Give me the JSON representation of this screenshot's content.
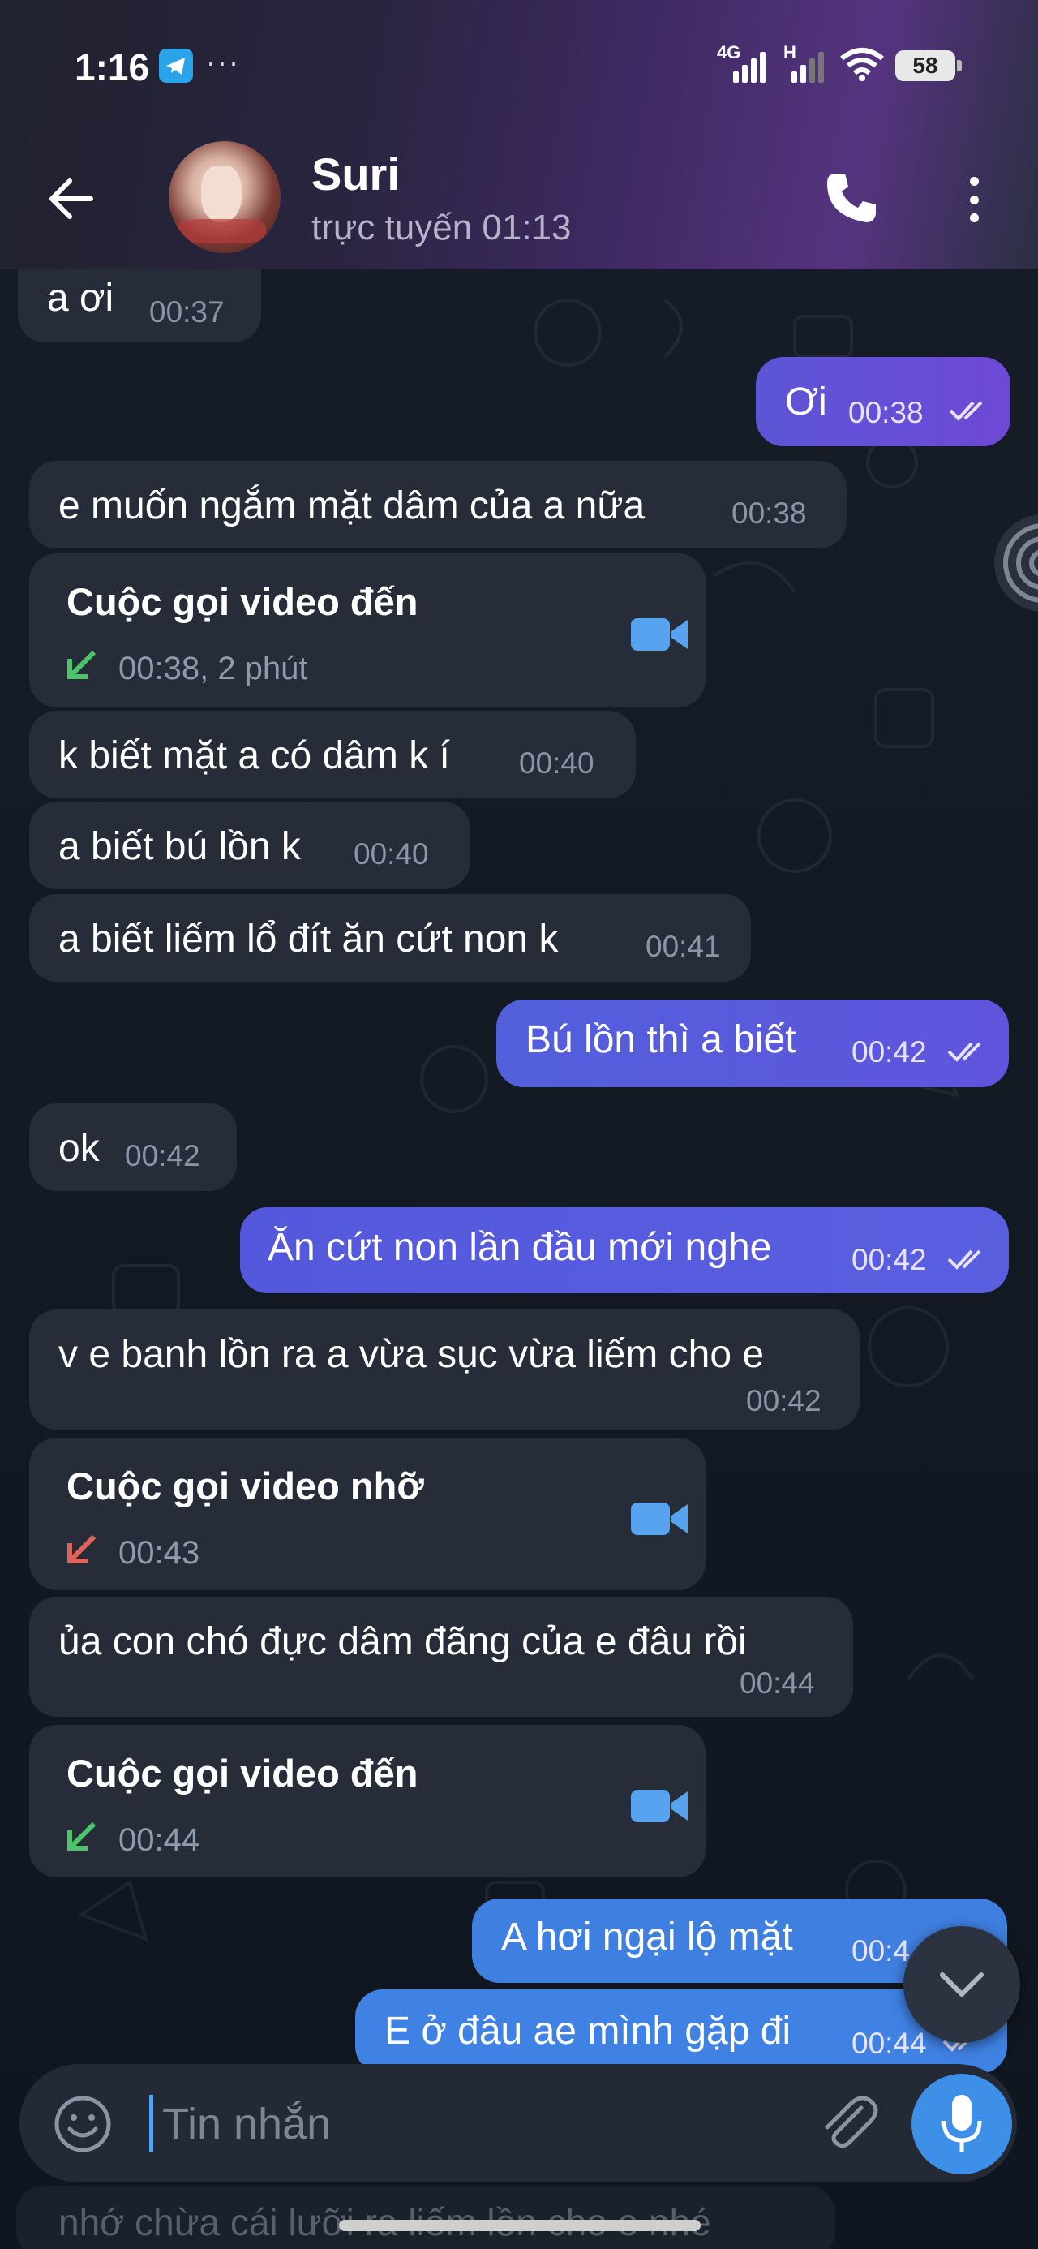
{
  "status_bar": {
    "time": "1:16",
    "more": "···",
    "net1": "4G",
    "net2": "H",
    "battery": "58"
  },
  "header": {
    "name": "Suri",
    "status": "trực tuyến 01:13"
  },
  "messages": [
    {
      "dir": "in",
      "text": "a ơi",
      "time": "00:37"
    },
    {
      "dir": "out",
      "text": "Ơi",
      "time": "00:38"
    },
    {
      "dir": "in",
      "text": "e muốn ngắm mặt dâm của a nữa",
      "time": "00:38"
    },
    {
      "dir": "call",
      "title": "Cuộc gọi video đến",
      "meta": "00:38, 2 phút",
      "kind": "incoming"
    },
    {
      "dir": "in",
      "text": "k biết mặt a có dâm k í",
      "time": "00:40"
    },
    {
      "dir": "in",
      "text": "a biết bú lồn k",
      "time": "00:40"
    },
    {
      "dir": "in",
      "text": "a biết liếm lổ đít ăn cứt non k",
      "time": "00:41"
    },
    {
      "dir": "out",
      "text": "Bú lồn thì a biết",
      "time": "00:42"
    },
    {
      "dir": "in",
      "text": "ok",
      "time": "00:42"
    },
    {
      "dir": "out",
      "text": "Ăn cứt non lần đầu mới nghe",
      "time": "00:42"
    },
    {
      "dir": "in",
      "text": "v e banh lồn ra a vừa sục vừa liếm cho e",
      "time": "00:42"
    },
    {
      "dir": "call",
      "title": "Cuộc gọi video nhỡ",
      "meta": "00:43",
      "kind": "missed"
    },
    {
      "dir": "in",
      "text": "ủa con chó đực dâm đãng của e đâu rồi",
      "time": "00:44"
    },
    {
      "dir": "call",
      "title": "Cuộc gọi video đến",
      "meta": "00:44",
      "kind": "incoming"
    },
    {
      "dir": "out",
      "text": "A hơi ngại lộ mặt",
      "time": "00:4"
    },
    {
      "dir": "out",
      "text": "E ở đâu ae mình gặp đi",
      "time": "00:44"
    }
  ],
  "ghost_message": "nhớ chừa cái lưỡi ra liếm lồn cho e nhé",
  "input": {
    "placeholder": "Tin nhắn"
  },
  "colors": {
    "incoming_bubble": "#262d39",
    "outgoing_bubble": "#5c55d6",
    "outgoing_bubble_blue": "#3f7fe0",
    "accent": "#3d8fe8",
    "missed_arrow": "#e0635c",
    "incoming_arrow": "#4cc46a"
  }
}
